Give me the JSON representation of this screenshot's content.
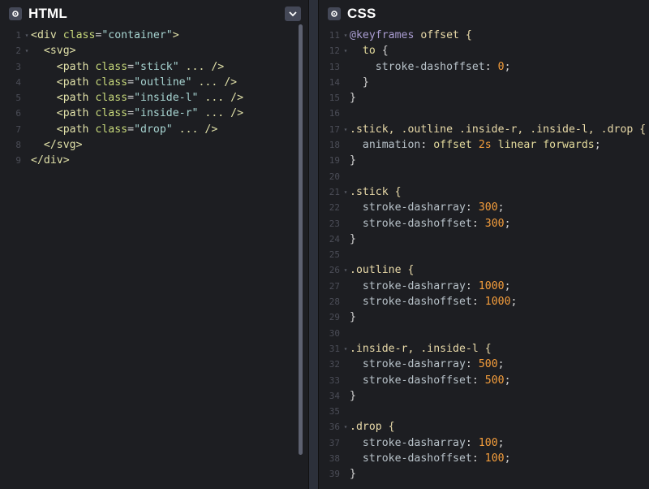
{
  "html_pane": {
    "title": "HTML",
    "settings_icon": "gear-icon",
    "collapse_icon": "chevron-down-icon",
    "lines": [
      {
        "n": "1",
        "fold": "▾",
        "tokens": [
          {
            "t": "<div ",
            "c": "t-tag"
          },
          {
            "t": "class",
            "c": "t-attr"
          },
          {
            "t": "=",
            "c": "t-plain"
          },
          {
            "t": "\"container\"",
            "c": "t-str"
          },
          {
            "t": ">",
            "c": "t-tag"
          }
        ]
      },
      {
        "n": "2",
        "fold": "▾",
        "tokens": [
          {
            "t": "  <svg>",
            "c": "t-tag"
          }
        ]
      },
      {
        "n": "3",
        "fold": "",
        "tokens": [
          {
            "t": "    <path ",
            "c": "t-tag"
          },
          {
            "t": "class",
            "c": "t-attr"
          },
          {
            "t": "=",
            "c": "t-plain"
          },
          {
            "t": "\"stick\"",
            "c": "t-str"
          },
          {
            "t": " ... />",
            "c": "t-tag"
          }
        ]
      },
      {
        "n": "4",
        "fold": "",
        "tokens": [
          {
            "t": "    <path ",
            "c": "t-tag"
          },
          {
            "t": "class",
            "c": "t-attr"
          },
          {
            "t": "=",
            "c": "t-plain"
          },
          {
            "t": "\"outline\"",
            "c": "t-str"
          },
          {
            "t": " ... />",
            "c": "t-tag"
          }
        ]
      },
      {
        "n": "5",
        "fold": "",
        "tokens": [
          {
            "t": "    <path ",
            "c": "t-tag"
          },
          {
            "t": "class",
            "c": "t-attr"
          },
          {
            "t": "=",
            "c": "t-plain"
          },
          {
            "t": "\"inside-l\"",
            "c": "t-str"
          },
          {
            "t": " ... />",
            "c": "t-tag"
          }
        ]
      },
      {
        "n": "6",
        "fold": "",
        "tokens": [
          {
            "t": "    <path ",
            "c": "t-tag"
          },
          {
            "t": "class",
            "c": "t-attr"
          },
          {
            "t": "=",
            "c": "t-plain"
          },
          {
            "t": "\"inside-r\"",
            "c": "t-str"
          },
          {
            "t": " ... />",
            "c": "t-tag"
          }
        ]
      },
      {
        "n": "7",
        "fold": "",
        "tokens": [
          {
            "t": "    <path ",
            "c": "t-tag"
          },
          {
            "t": "class",
            "c": "t-attr"
          },
          {
            "t": "=",
            "c": "t-plain"
          },
          {
            "t": "\"drop\"",
            "c": "t-str"
          },
          {
            "t": " ... />",
            "c": "t-tag"
          }
        ]
      },
      {
        "n": "8",
        "fold": "",
        "tokens": [
          {
            "t": "  </svg>",
            "c": "t-tag"
          }
        ]
      },
      {
        "n": "9",
        "fold": "",
        "tokens": [
          {
            "t": "</div>",
            "c": "t-tag"
          }
        ]
      }
    ]
  },
  "css_pane": {
    "title": "CSS",
    "settings_icon": "gear-icon",
    "lines": [
      {
        "n": "11",
        "fold": "▾",
        "tokens": [
          {
            "t": "@keyframes",
            "c": "t-at"
          },
          {
            "t": " offset {",
            "c": "t-sel"
          }
        ]
      },
      {
        "n": "12",
        "fold": "▾",
        "tokens": [
          {
            "t": "  to",
            "c": "t-kw"
          },
          {
            "t": " {",
            "c": "t-plain"
          }
        ]
      },
      {
        "n": "13",
        "fold": "",
        "tokens": [
          {
            "t": "    stroke-dashoffset",
            "c": "t-prop"
          },
          {
            "t": ": ",
            "c": "t-plain"
          },
          {
            "t": "0",
            "c": "t-num"
          },
          {
            "t": ";",
            "c": "t-plain"
          }
        ]
      },
      {
        "n": "14",
        "fold": "",
        "tokens": [
          {
            "t": "  }",
            "c": "t-plain"
          }
        ]
      },
      {
        "n": "15",
        "fold": "",
        "tokens": [
          {
            "t": "}",
            "c": "t-plain"
          }
        ]
      },
      {
        "n": "16",
        "fold": "",
        "tokens": []
      },
      {
        "n": "17",
        "fold": "▾",
        "tokens": [
          {
            "t": ".stick, .outline .inside-r, .inside-l, .drop {",
            "c": "t-sel"
          }
        ]
      },
      {
        "n": "18",
        "fold": "",
        "tokens": [
          {
            "t": "  animation",
            "c": "t-prop"
          },
          {
            "t": ": ",
            "c": "t-plain"
          },
          {
            "t": "offset ",
            "c": "t-val"
          },
          {
            "t": "2s",
            "c": "t-num"
          },
          {
            "t": " linear forwards",
            "c": "t-val"
          },
          {
            "t": ";",
            "c": "t-plain"
          }
        ]
      },
      {
        "n": "19",
        "fold": "",
        "tokens": [
          {
            "t": "}",
            "c": "t-plain"
          }
        ]
      },
      {
        "n": "20",
        "fold": "",
        "tokens": []
      },
      {
        "n": "21",
        "fold": "▾",
        "tokens": [
          {
            "t": ".stick {",
            "c": "t-sel"
          }
        ]
      },
      {
        "n": "22",
        "fold": "",
        "tokens": [
          {
            "t": "  stroke-dasharray",
            "c": "t-prop"
          },
          {
            "t": ": ",
            "c": "t-plain"
          },
          {
            "t": "300",
            "c": "t-num"
          },
          {
            "t": ";",
            "c": "t-plain"
          }
        ]
      },
      {
        "n": "23",
        "fold": "",
        "tokens": [
          {
            "t": "  stroke-dashoffset",
            "c": "t-prop"
          },
          {
            "t": ": ",
            "c": "t-plain"
          },
          {
            "t": "300",
            "c": "t-num"
          },
          {
            "t": ";",
            "c": "t-plain"
          }
        ]
      },
      {
        "n": "24",
        "fold": "",
        "tokens": [
          {
            "t": "}",
            "c": "t-plain"
          }
        ]
      },
      {
        "n": "25",
        "fold": "",
        "tokens": []
      },
      {
        "n": "26",
        "fold": "▾",
        "tokens": [
          {
            "t": ".outline {",
            "c": "t-sel"
          }
        ]
      },
      {
        "n": "27",
        "fold": "",
        "tokens": [
          {
            "t": "  stroke-dasharray",
            "c": "t-prop"
          },
          {
            "t": ": ",
            "c": "t-plain"
          },
          {
            "t": "1000",
            "c": "t-num"
          },
          {
            "t": ";",
            "c": "t-plain"
          }
        ]
      },
      {
        "n": "28",
        "fold": "",
        "tokens": [
          {
            "t": "  stroke-dashoffset",
            "c": "t-prop"
          },
          {
            "t": ": ",
            "c": "t-plain"
          },
          {
            "t": "1000",
            "c": "t-num"
          },
          {
            "t": ";",
            "c": "t-plain"
          }
        ]
      },
      {
        "n": "29",
        "fold": "",
        "tokens": [
          {
            "t": "}",
            "c": "t-plain"
          }
        ]
      },
      {
        "n": "30",
        "fold": "",
        "tokens": []
      },
      {
        "n": "31",
        "fold": "▾",
        "tokens": [
          {
            "t": ".inside-r, .inside-l {",
            "c": "t-sel"
          }
        ]
      },
      {
        "n": "32",
        "fold": "",
        "tokens": [
          {
            "t": "  stroke-dasharray",
            "c": "t-prop"
          },
          {
            "t": ": ",
            "c": "t-plain"
          },
          {
            "t": "500",
            "c": "t-num"
          },
          {
            "t": ";",
            "c": "t-plain"
          }
        ]
      },
      {
        "n": "33",
        "fold": "",
        "tokens": [
          {
            "t": "  stroke-dashoffset",
            "c": "t-prop"
          },
          {
            "t": ": ",
            "c": "t-plain"
          },
          {
            "t": "500",
            "c": "t-num"
          },
          {
            "t": ";",
            "c": "t-plain"
          }
        ]
      },
      {
        "n": "34",
        "fold": "",
        "tokens": [
          {
            "t": "}",
            "c": "t-plain"
          }
        ]
      },
      {
        "n": "35",
        "fold": "",
        "tokens": []
      },
      {
        "n": "36",
        "fold": "▾",
        "tokens": [
          {
            "t": ".drop {",
            "c": "t-sel"
          }
        ]
      },
      {
        "n": "37",
        "fold": "",
        "tokens": [
          {
            "t": "  stroke-dasharray",
            "c": "t-prop"
          },
          {
            "t": ": ",
            "c": "t-plain"
          },
          {
            "t": "100",
            "c": "t-num"
          },
          {
            "t": ";",
            "c": "t-plain"
          }
        ]
      },
      {
        "n": "38",
        "fold": "",
        "tokens": [
          {
            "t": "  stroke-dashoffset",
            "c": "t-prop"
          },
          {
            "t": ": ",
            "c": "t-plain"
          },
          {
            "t": "100",
            "c": "t-num"
          },
          {
            "t": ";",
            "c": "t-plain"
          }
        ]
      },
      {
        "n": "39",
        "fold": "",
        "tokens": [
          {
            "t": "}",
            "c": "t-plain"
          }
        ]
      }
    ]
  },
  "colors": {
    "background": "#1d1e22",
    "number": "#f59e3c",
    "at_rule": "#a99cd1",
    "selector": "#e8d9a8",
    "string": "#a8d5d2"
  }
}
